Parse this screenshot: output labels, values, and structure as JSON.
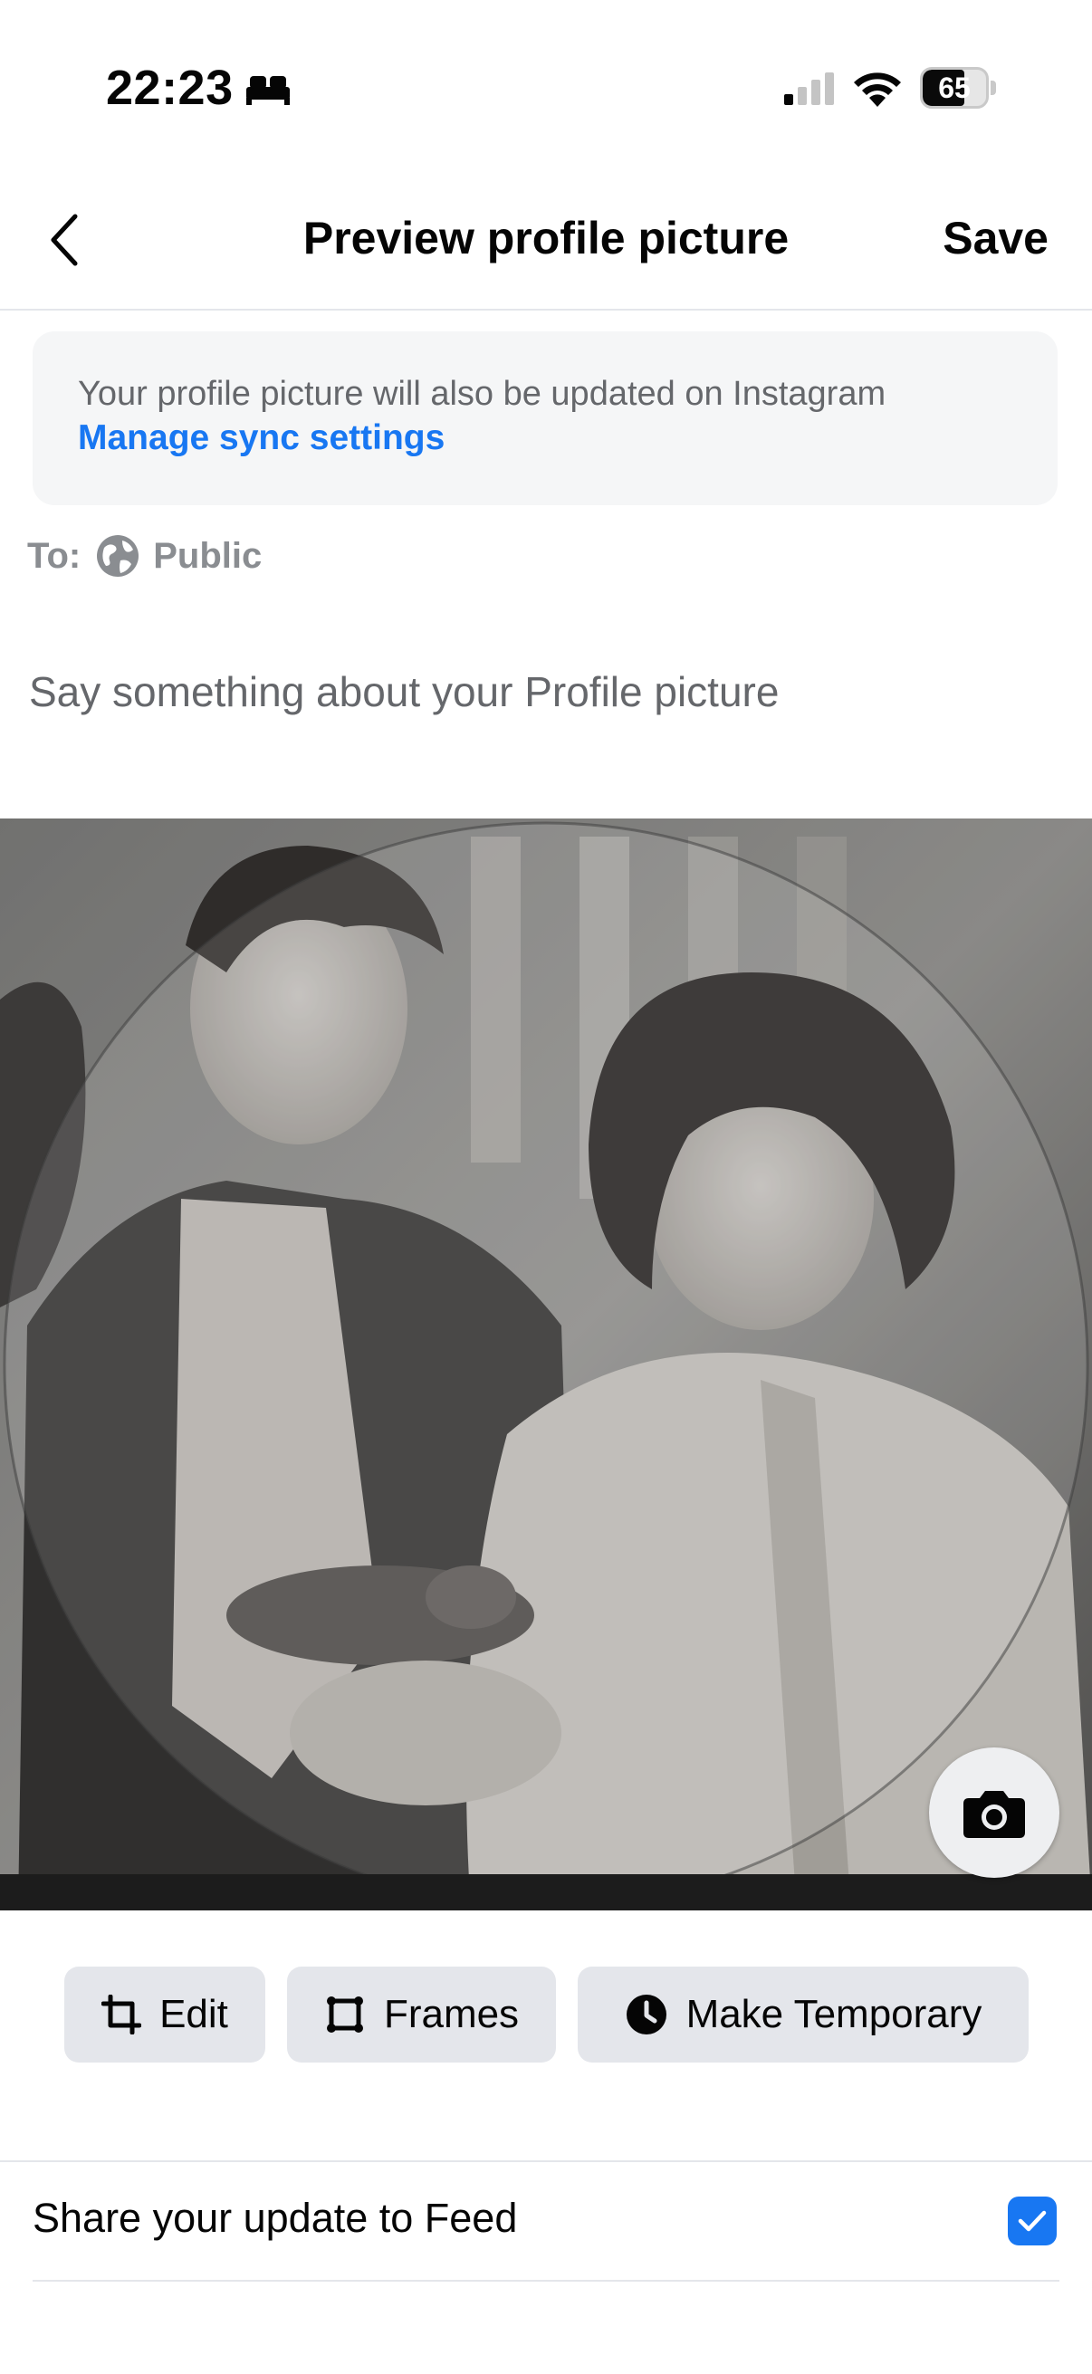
{
  "status_bar": {
    "time": "22:23",
    "battery_level": "65",
    "battery_fraction": 0.65
  },
  "header": {
    "title": "Preview profile picture",
    "save_label": "Save"
  },
  "sync_banner": {
    "text": "Your profile picture will also be updated on Instagram",
    "link_label": "Manage sync settings"
  },
  "audience": {
    "label": "To:",
    "value": "Public"
  },
  "caption": {
    "placeholder": "Say something about your Profile picture"
  },
  "actions": {
    "edit_label": "Edit",
    "frames_label": "Frames",
    "temporary_label": "Make Temporary"
  },
  "share": {
    "label": "Share your update to Feed",
    "checked": true
  },
  "colors": {
    "accent": "#1877f2",
    "text_primary": "#050505",
    "text_secondary": "#65676b",
    "button_bg": "#e4e6eb"
  },
  "icons": [
    "sleep-icon",
    "signal-icon",
    "wifi-icon",
    "battery-icon",
    "back-arrow-icon",
    "globe-icon",
    "camera-icon",
    "crop-icon",
    "frame-icon",
    "clock-icon",
    "checkmark-icon"
  ]
}
